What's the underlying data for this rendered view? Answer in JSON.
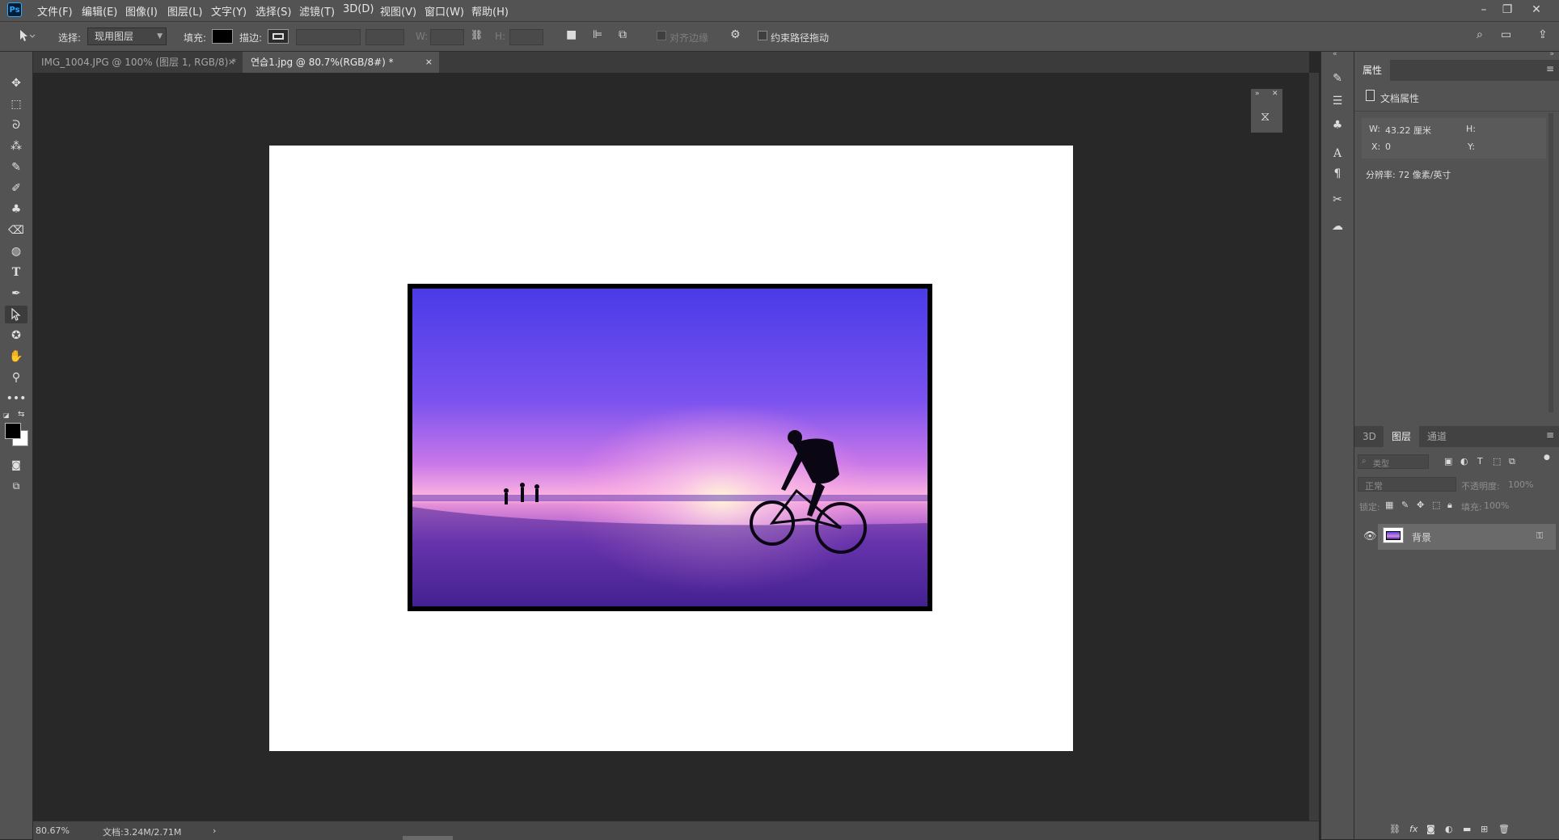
{
  "app": {
    "logo_text": "Ps"
  },
  "menubar": {
    "items": [
      "文件(F)",
      "编辑(E)",
      "图像(I)",
      "图层(L)",
      "文字(Y)",
      "选择(S)",
      "滤镜(T)",
      "3D(D)",
      "视图(V)",
      "窗口(W)",
      "帮助(H)"
    ],
    "window_controls": {
      "minimize": "–",
      "restore": "❐",
      "close": "✕"
    }
  },
  "options": {
    "select_label": "选择:",
    "select_value": "现用图层",
    "fill_label": "填充:",
    "fill_color": "#000000",
    "stroke_label": "描边:",
    "w_label": "W:",
    "h_label": "H:",
    "align_edges_label": "对齐边缘",
    "constrain_path_label": "约束路径拖动"
  },
  "tabs": [
    {
      "label": "IMG_1004.JPG @ 100% (图层 1, RGB/8) *",
      "close": "×",
      "active": false
    },
    {
      "label": "연습1.jpg @ 80.7%(RGB/8#) *",
      "close": "×",
      "active": true
    }
  ],
  "status": {
    "zoom": "80.67%",
    "doc_info": "文档:3.24M/2.71M",
    "arrow": "›"
  },
  "properties_panel": {
    "tab": "属性",
    "menu": "≡",
    "section_title": "文档属性",
    "w_label": "W:",
    "w_value": "43.22 厘米",
    "h_label": "H:",
    "x_label": "X:",
    "x_value": "0",
    "y_label": "Y:",
    "resolution": "分辨率: 72 像素/英寸"
  },
  "layers_panel": {
    "tabs": [
      "3D",
      "图层",
      "通道"
    ],
    "active_tab": "图层",
    "menu": "≡",
    "filter_placeholder": "类型",
    "blend_mode": "正常",
    "opacity_label": "不透明度:",
    "opacity_value": "100%",
    "lock_label": "锁定:",
    "fill_label": "填充:",
    "fill_value": "100%",
    "layer_name": "背景"
  },
  "colors": {
    "ui_panel": "#535353",
    "canvas_bg": "#282828",
    "accent": "#31a8ff"
  }
}
